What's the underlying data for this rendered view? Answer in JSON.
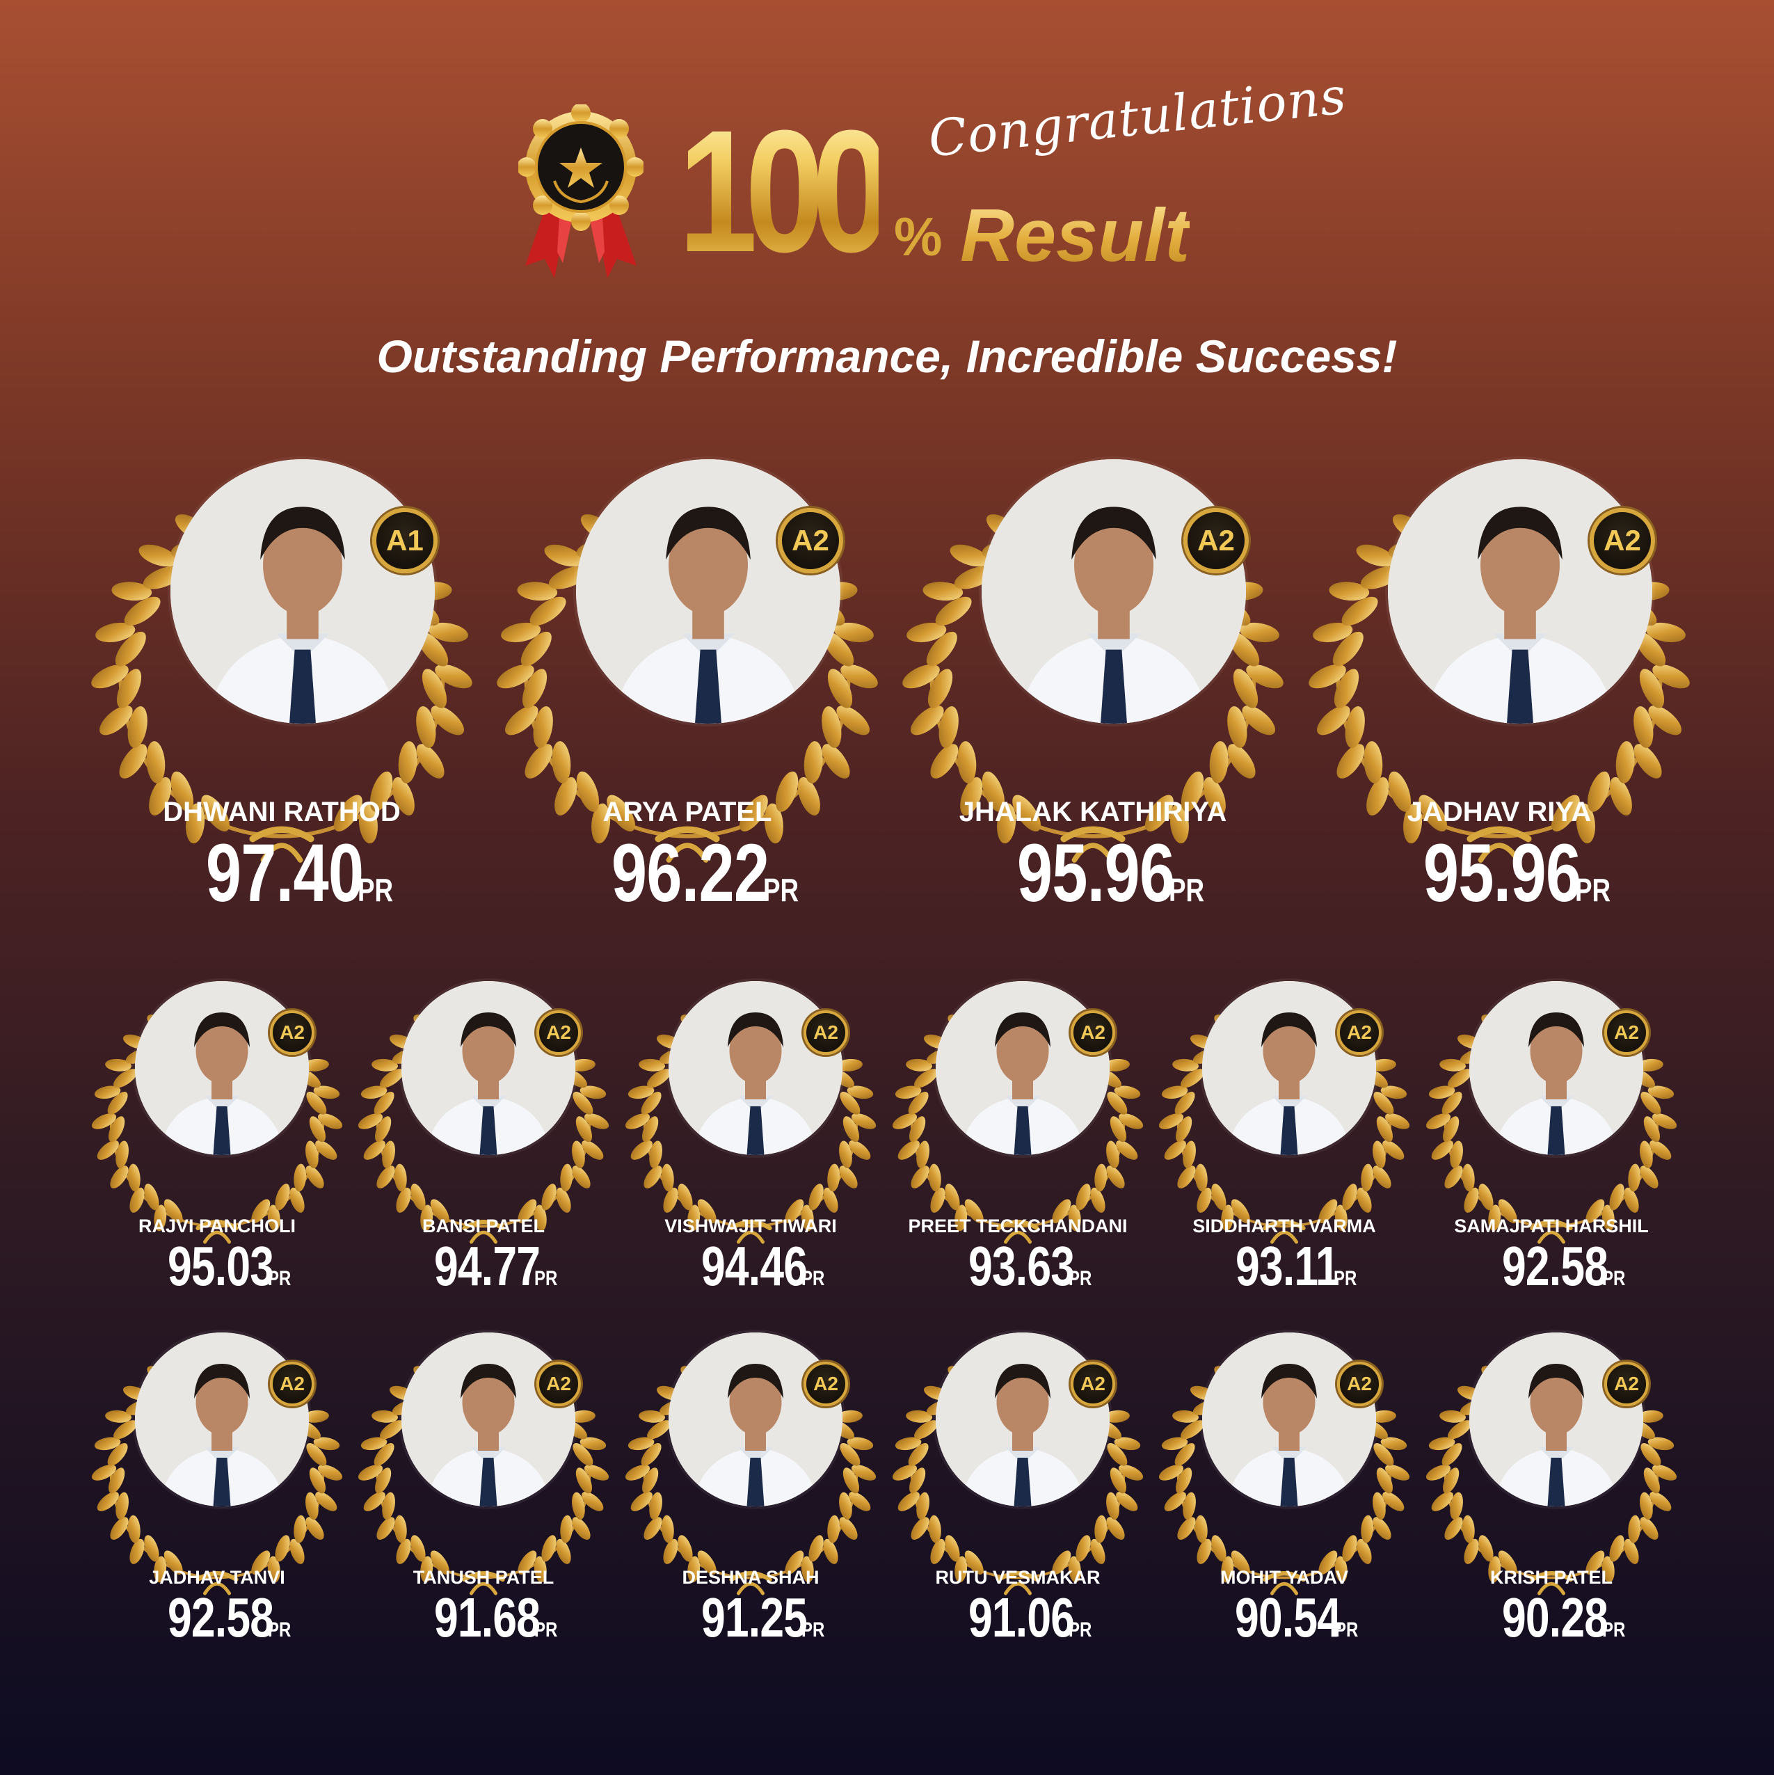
{
  "header": {
    "hundred": "100",
    "percent": "%",
    "congratulations": "Congratulations",
    "result": "Result",
    "tagline": "Outstanding Performance, Incredible Success!"
  },
  "colors": {
    "gold": "#d7a63c",
    "gold_light": "#f3cf63",
    "ribbon_red": "#c81e1e",
    "badge_dark": "#17120b",
    "bg_top": "#a84f32",
    "bg_bottom": "#0d0b22"
  },
  "score_unit": "PR",
  "students": [
    {
      "name": "DHWANI RATHOD",
      "score": "97.40",
      "grade": "A1"
    },
    {
      "name": "ARYA PATEL",
      "score": "96.22",
      "grade": "A2"
    },
    {
      "name": "JHALAK KATHIRIYA",
      "score": "95.96",
      "grade": "A2"
    },
    {
      "name": "JADHAV RIYA",
      "score": "95.96",
      "grade": "A2"
    },
    {
      "name": "RAJVI PANCHOLI",
      "score": "95.03",
      "grade": "A2"
    },
    {
      "name": "BANSI PATEL",
      "score": "94.77",
      "grade": "A2"
    },
    {
      "name": "VISHWAJIT TIWARI",
      "score": "94.46",
      "grade": "A2"
    },
    {
      "name": "PREET TECKCHANDANI",
      "score": "93.63",
      "grade": "A2"
    },
    {
      "name": "SIDDHARTH VARMA",
      "score": "93.11",
      "grade": "A2"
    },
    {
      "name": "SAMAJPATI HARSHIL",
      "score": "92.58",
      "grade": "A2"
    },
    {
      "name": "JADHAV TANVI",
      "score": "92.58",
      "grade": "A2"
    },
    {
      "name": "TANUSH PATEL",
      "score": "91.68",
      "grade": "A2"
    },
    {
      "name": "DESHNA SHAH",
      "score": "91.25",
      "grade": "A2"
    },
    {
      "name": "RUTU VESMAKAR",
      "score": "91.06",
      "grade": "A2"
    },
    {
      "name": "MOHIT YADAV",
      "score": "90.54",
      "grade": "A2"
    },
    {
      "name": "KRISH PATEL",
      "score": "90.28",
      "grade": "A2"
    }
  ]
}
